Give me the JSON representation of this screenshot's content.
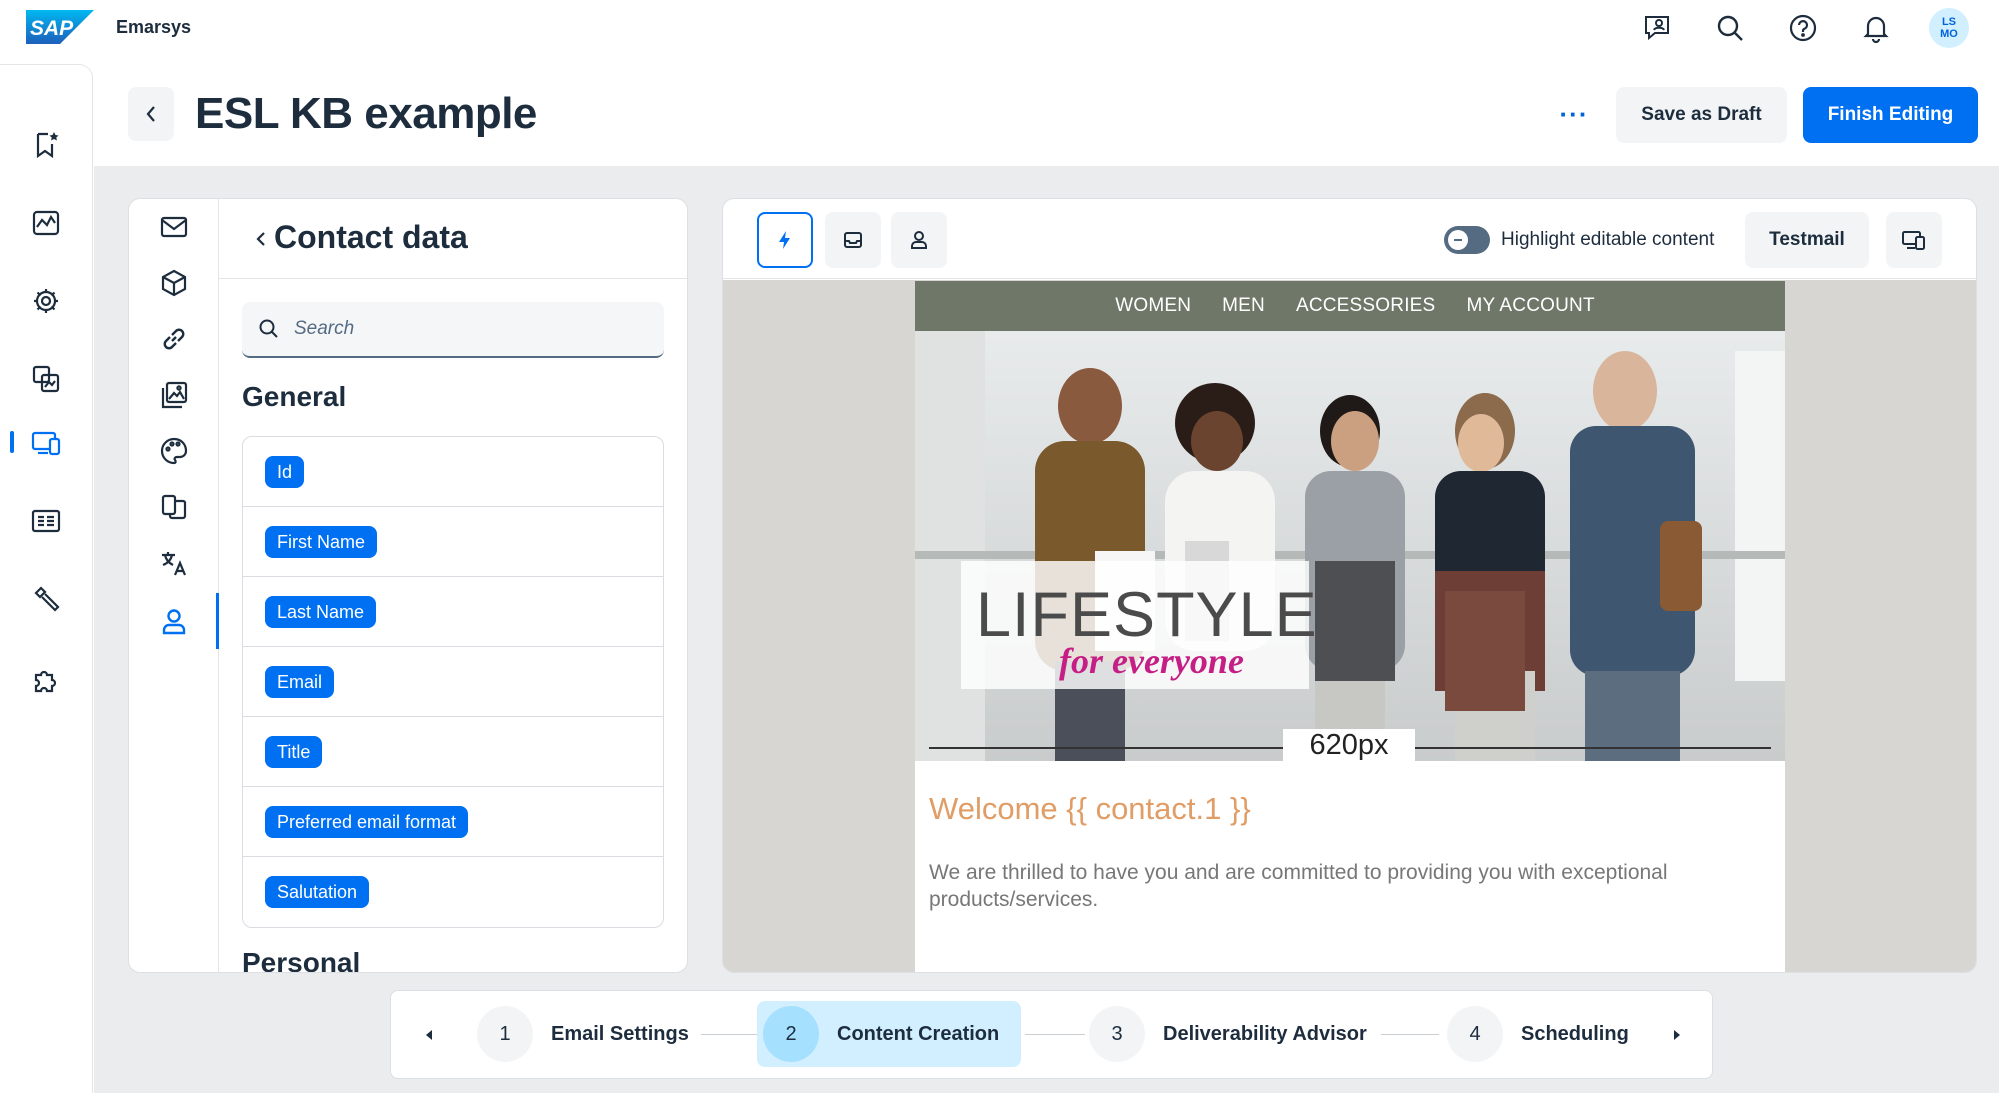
{
  "shell": {
    "logo_text": "SAP",
    "product_name": "Emarsys",
    "avatar_initials_line1": "LS",
    "avatar_initials_line2": "MO",
    "icons": [
      "feedback-icon",
      "search-icon",
      "help-icon",
      "notification-icon"
    ]
  },
  "sidenav": {
    "icons": [
      "bookmark-star-icon",
      "analytics-icon",
      "automation-gear-icon",
      "content-icon",
      "email-campaign-icon",
      "web-channel-icon",
      "tools-icon",
      "add-ons-icon"
    ],
    "active_index": 4
  },
  "header": {
    "title": "ESL KB example",
    "more_label": "···",
    "save_draft_label": "Save as Draft",
    "finish_label": "Finish Editing"
  },
  "left_panel": {
    "tool_icons": [
      "mail-icon",
      "block-icon",
      "link-icon",
      "image-gallery-icon",
      "palette-icon",
      "copy-icon",
      "translate-icon",
      "person-icon"
    ],
    "active_tool_index": 7,
    "title": "Contact data",
    "search_placeholder": "Search",
    "section_general": "General",
    "fields": [
      "Id",
      "First Name",
      "Last Name",
      "Email",
      "Title",
      "Preferred email format",
      "Salutation"
    ],
    "section_personal": "Personal"
  },
  "preview": {
    "toolbar_buttons": [
      "lightning-icon",
      "inbox-icon",
      "person-icon"
    ],
    "highlight_label": "Highlight editable content",
    "testmail_label": "Testmail",
    "email": {
      "nav_items": [
        "WOMEN",
        "MEN",
        "ACCESSORIES",
        "MY ACCOUNT"
      ],
      "hero_title": "LIFESTYLE",
      "hero_subtitle": "for everyone",
      "width_label": "620px",
      "welcome": "Welcome {{ contact.1 }}",
      "body": "We are thrilled to have you and are committed to providing you with exceptional products/services."
    }
  },
  "stepper": {
    "steps": [
      {
        "number": "1",
        "label": "Email Settings"
      },
      {
        "number": "2",
        "label": "Content Creation"
      },
      {
        "number": "3",
        "label": "Deliverability Advisor"
      },
      {
        "number": "4",
        "label": "Scheduling"
      }
    ],
    "active_index": 1
  },
  "colors": {
    "brand_blue": "#0070f2",
    "email_nav": "#6f7769",
    "welcome": "#e09d66",
    "hero_subtitle": "#c51f86"
  }
}
